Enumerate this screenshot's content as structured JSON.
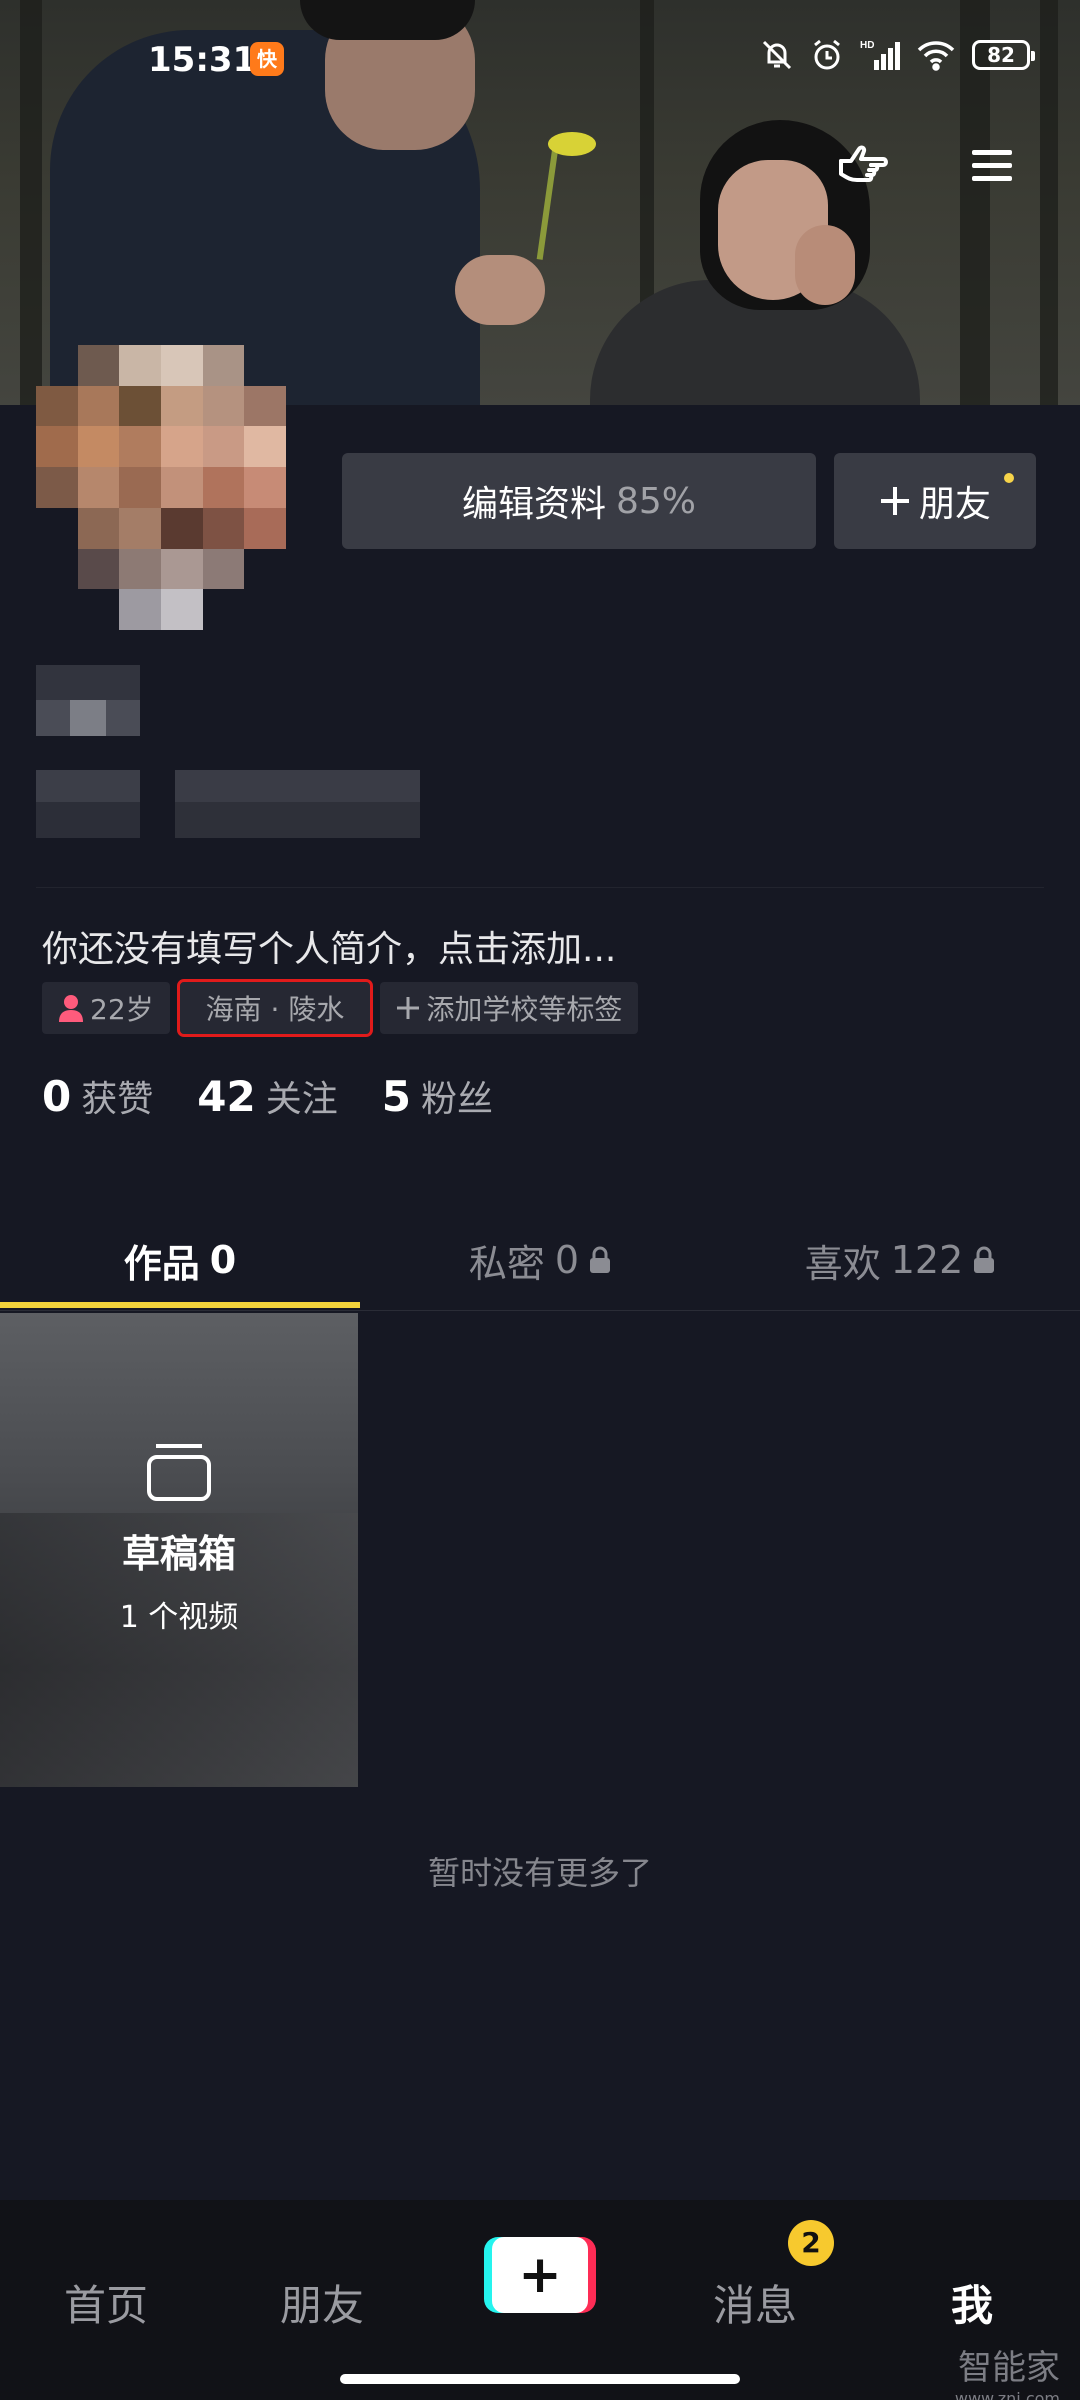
{
  "status_bar": {
    "time": "15:31",
    "app_icon_text": "快",
    "battery": "82"
  },
  "profile": {
    "edit_button": {
      "label": "编辑资料",
      "percent": "85%"
    },
    "friend_button": {
      "label": "朋友",
      "icon": "plus-icon"
    },
    "bio": "你还没有填写个人简介，点击添加...",
    "tags": {
      "age": "22岁",
      "location": "海南 · 陵水",
      "add_school": "添加学校等标签"
    },
    "stats": [
      {
        "value": "0",
        "label": "获赞"
      },
      {
        "value": "42",
        "label": "关注"
      },
      {
        "value": "5",
        "label": "粉丝"
      }
    ]
  },
  "tabs": [
    {
      "label": "作品",
      "count": "0",
      "locked": false,
      "active": true
    },
    {
      "label": "私密",
      "count": "0",
      "locked": true,
      "active": false
    },
    {
      "label": "喜欢",
      "count": "122",
      "locked": true,
      "active": false
    }
  ],
  "draft": {
    "title": "草稿箱",
    "count": "1 个视频"
  },
  "empty_hint": "暂时没有更多了",
  "bottom_nav": {
    "home": "首页",
    "friends": "朋友",
    "messages": "消息",
    "messages_badge": "2",
    "me": "我"
  },
  "watermark": {
    "name": "智能家",
    "url": "www.znj.com"
  },
  "colors": {
    "background": "#161823",
    "tab_indicator": "#f3d33b",
    "highlight_box": "#e11b1b",
    "badge": "#f7c92e",
    "age_icon": "#fe5b7c"
  }
}
